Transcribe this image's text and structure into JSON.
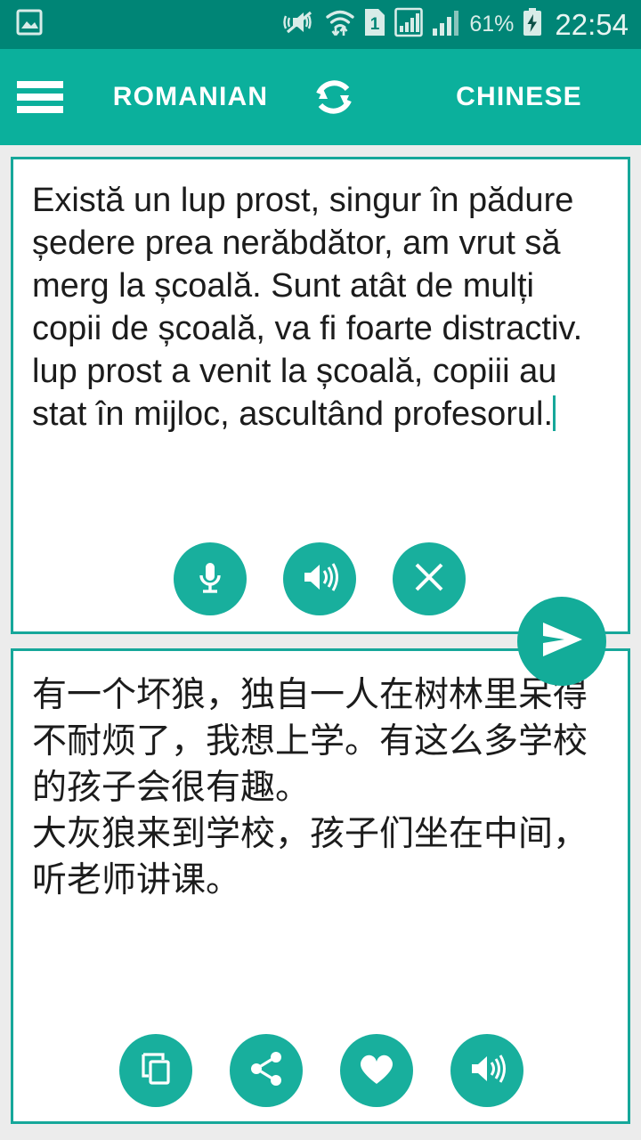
{
  "status_bar": {
    "notification_icon": "image-gallery-icon",
    "icons": [
      "vibrate-mute-icon",
      "wifi-transfer-icon",
      "sim-1-icon",
      "signal-bars-1-icon",
      "signal-bars-2-icon"
    ],
    "battery_percent": "61%",
    "battery_state": "charging-battery-icon",
    "clock": "22:54",
    "background_color": "#008576",
    "text_color": "#d8ece8"
  },
  "app_bar": {
    "menu_icon": "hamburger-menu-icon",
    "source_language": "ROMANIAN",
    "swap_icon": "swap-languages-icon",
    "target_language": "CHINESE",
    "background_color": "#0bb09c",
    "text_color": "#ffffff"
  },
  "source_card": {
    "text": "Există un lup prost, singur în pădure ședere prea nerăbdător, am vrut să merg la școală. Sunt atât de mulți copii de școală, va fi foarte distractiv.\nlup prost a venit la școală, copiii au stat în mijloc, ascultând profesorul.",
    "placeholder": "Enter text",
    "caret_visible": true,
    "actions": [
      {
        "name": "microphone-button",
        "icon": "microphone-icon",
        "label": "Voice input"
      },
      {
        "name": "speak-source-button",
        "icon": "speaker-icon",
        "label": "Speak"
      },
      {
        "name": "clear-text-button",
        "icon": "close-icon",
        "label": "Clear"
      }
    ]
  },
  "send_button": {
    "name": "translate-send-button",
    "icon": "send-paper-plane-icon",
    "label": "Translate",
    "color": "#13ac99"
  },
  "target_card": {
    "text": "有一个坏狼，独自一人在树林里呆得不耐烦了，我想上学。有这么多学校的孩子会很有趣。\n大灰狼来到学校，孩子们坐在中间，听老师讲课。",
    "actions": [
      {
        "name": "copy-button",
        "icon": "copy-icon",
        "label": "Copy"
      },
      {
        "name": "share-button",
        "icon": "share-icon",
        "label": "Share"
      },
      {
        "name": "favorite-button",
        "icon": "heart-icon",
        "label": "Favorite"
      },
      {
        "name": "speak-target-button",
        "icon": "speaker-icon",
        "label": "Speak"
      }
    ]
  },
  "theme": {
    "accent": "#0bb09c",
    "accent_dark": "#008576",
    "button_fill": "#18af9d",
    "card_border": "#16a79a",
    "page_background": "#ececec",
    "card_background": "#ffffff"
  }
}
